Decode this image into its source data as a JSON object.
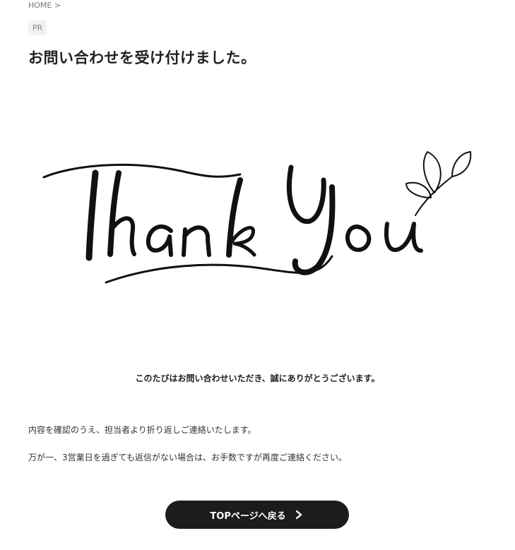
{
  "breadcrumb": {
    "home": "HOME",
    "separator": ">"
  },
  "badge": {
    "pr": "PR"
  },
  "page": {
    "title": "お問い合わせを受け付けました。"
  },
  "hero": {
    "alt_text": "Thank You"
  },
  "message": {
    "lead": "このたびはお問い合わせいただき、誠にありがとうございます。",
    "line1": "内容を確認のうえ、担当者より折り返しご連絡いたします。",
    "line2": "万が一、3営業日を過ぎても返信がない場合は、お手数ですが再度ご連絡ください。"
  },
  "button": {
    "top_label": "TOPページへ戻る",
    "icon": "chevron-right-icon"
  },
  "colors": {
    "button_bg": "#1c1c1c",
    "text": "#333333",
    "badge_bg": "#f2f2f2"
  }
}
